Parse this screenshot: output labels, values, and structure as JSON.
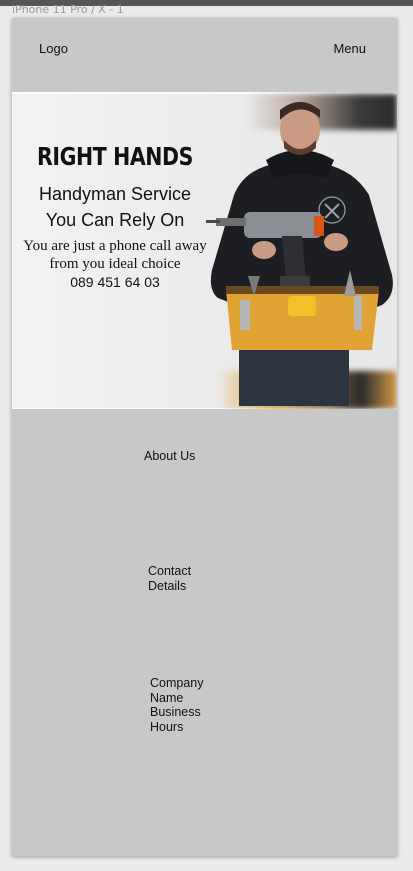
{
  "frame": {
    "label": "iPhone 11 Pro / X - 1"
  },
  "header": {
    "logo": "Logo",
    "menu": "Menu"
  },
  "hero": {
    "brand": "RIGHT HANDS",
    "tagline_1": "Handyman Service",
    "tagline_2": "You Can Rely On",
    "body_1": "You are just a phone call away",
    "body_2": "from you ideal choice",
    "phone": "089 451 64 03"
  },
  "sections": {
    "about": "About Us",
    "contact_1": "Contact",
    "contact_2": "Details",
    "company_1": "Company",
    "company_2": "Name",
    "company_3": "Business",
    "company_4": "Hours"
  }
}
